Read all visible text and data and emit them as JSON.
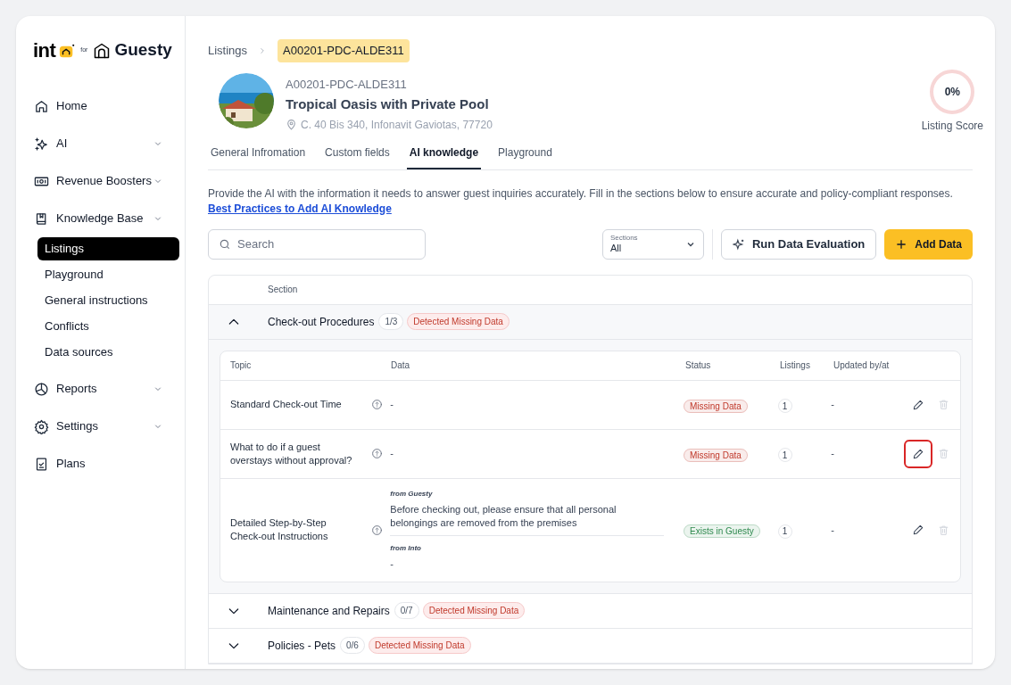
{
  "brand": {
    "name": "int",
    "for": "for",
    "partner": "Guesty"
  },
  "sidebar": {
    "items": [
      {
        "label": "Home",
        "expandable": false
      },
      {
        "label": "AI",
        "expandable": true
      },
      {
        "label": "Revenue Boosters",
        "expandable": true
      },
      {
        "label": "Knowledge Base",
        "expandable": true,
        "children": [
          {
            "label": "Listings",
            "selected": true
          },
          {
            "label": "Playground",
            "selected": false
          },
          {
            "label": "General instructions",
            "selected": false
          },
          {
            "label": "Conflicts",
            "selected": false
          },
          {
            "label": "Data sources",
            "selected": false
          }
        ]
      },
      {
        "label": "Reports",
        "expandable": true
      },
      {
        "label": "Settings",
        "expandable": true
      },
      {
        "label": "Plans",
        "expandable": false
      }
    ]
  },
  "breadcrumb": [
    "Listings",
    "A00201-PDC-ALDE311"
  ],
  "listing": {
    "code": "A00201-PDC-ALDE311",
    "name": "Tropical Oasis with Private Pool",
    "address": "C. 40 Bis 340, Infonavit Gaviotas, 77720"
  },
  "score": {
    "value": "0%",
    "label": "Listing Score"
  },
  "tabs": [
    {
      "label": "General Infromation",
      "selected": false
    },
    {
      "label": "Custom fields",
      "selected": false
    },
    {
      "label": "AI knowledge",
      "selected": true
    },
    {
      "label": "Playground",
      "selected": false
    }
  ],
  "description": "Provide the AI with the information it needs to answer guest inquiries accurately. Fill in the sections below to ensure accurate and policy-compliant responses.",
  "help_link": "Best Practices to Add AI Knowledge",
  "search": {
    "placeholder": "Search"
  },
  "sections_filter": {
    "label": "Sections",
    "value": "All"
  },
  "buttons": {
    "evaluate": "Run Data Evaluation",
    "add": "Add Data"
  },
  "table": {
    "column": "Section",
    "sections": [
      {
        "name": "Check-out Procedures",
        "count": "1/3",
        "badge": "Detected Missing Data",
        "expanded": true,
        "columns": [
          "Topic",
          "Data",
          "Status",
          "Listings",
          "Updated by/at"
        ],
        "rows": [
          {
            "topic": "Standard Check-out Time",
            "kind": "plain",
            "data": "-",
            "status": "Missing Data",
            "color": "#c0392b",
            "listings": "1",
            "updated": "-",
            "highlighted": false
          },
          {
            "topic": "What to do if a guest overstays without approval?",
            "kind": "plain",
            "data": "-",
            "status": "Missing Data",
            "color": "#c0392b",
            "listings": "1",
            "updated": "-",
            "highlighted": true
          },
          {
            "topic": "Detailed Step-by-Step Check-out Instructions",
            "kind": "sources",
            "sources": [
              {
                "label": "from Guesty",
                "text": "Before checking out, please ensure that all personal belongings are removed from the premises"
              },
              {
                "label": "from Into",
                "text": "-"
              }
            ],
            "status": "Exists in Guesty",
            "color": "#2f8a4f",
            "listings": "1",
            "updated": "-",
            "highlighted": false
          }
        ]
      },
      {
        "name": "Maintenance and Repairs",
        "count": "0/7",
        "badge": "Detected Missing Data",
        "expanded": false
      },
      {
        "name": "Policies - Pets",
        "count": "0/6",
        "badge": "Detected Missing Data",
        "expanded": false
      }
    ]
  }
}
